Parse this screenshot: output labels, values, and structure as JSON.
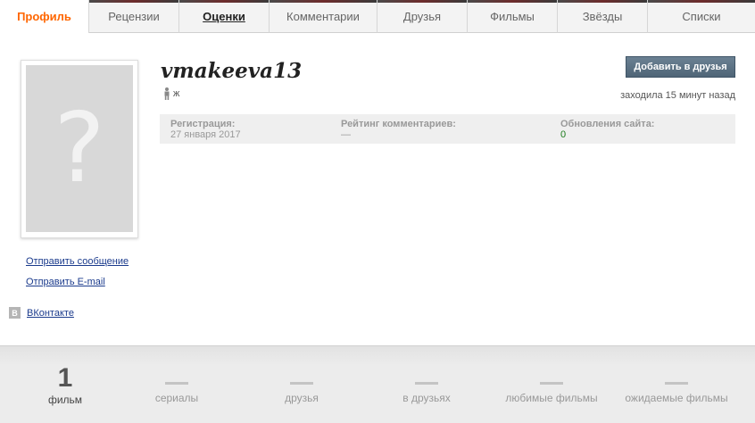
{
  "tabs": [
    {
      "label": "Профиль"
    },
    {
      "label": "Рецензии"
    },
    {
      "label": "Оценки"
    },
    {
      "label": "Комментарии"
    },
    {
      "label": "Друзья"
    },
    {
      "label": "Фильмы"
    },
    {
      "label": "Звёзды"
    },
    {
      "label": "Списки"
    }
  ],
  "profile": {
    "username": "vmakeeva13",
    "gender": "ж",
    "last_seen": "заходила 15 минут назад",
    "add_friend_label": "Добавить в друзья",
    "avatar_placeholder": "?"
  },
  "stats": {
    "registration_label": "Регистрация:",
    "registration_value": "27 января 2017",
    "comment_rating_label": "Рейтинг комментариев:",
    "comment_rating_value": "—",
    "site_updates_label": "Обновления сайта:",
    "site_updates_value": "0"
  },
  "sidebar": {
    "send_message": "Отправить сообщение",
    "send_email": "Отправить E-mail",
    "vk_icon": "В",
    "vk_label": "ВКонтакте"
  },
  "footer": [
    {
      "value": "1",
      "label": "фильм"
    },
    {
      "value": "—",
      "label": "сериалы"
    },
    {
      "value": "—",
      "label": "друзья"
    },
    {
      "value": "—",
      "label": "в друзьях"
    },
    {
      "value": "—",
      "label": "любимые фильмы"
    },
    {
      "value": "—",
      "label": "ожидаемые фильмы"
    }
  ],
  "colors": {
    "active_tab": "#ff6600",
    "link": "#1a3a8c",
    "button": "#5a7083",
    "updates_value": "#1a7a1a"
  }
}
